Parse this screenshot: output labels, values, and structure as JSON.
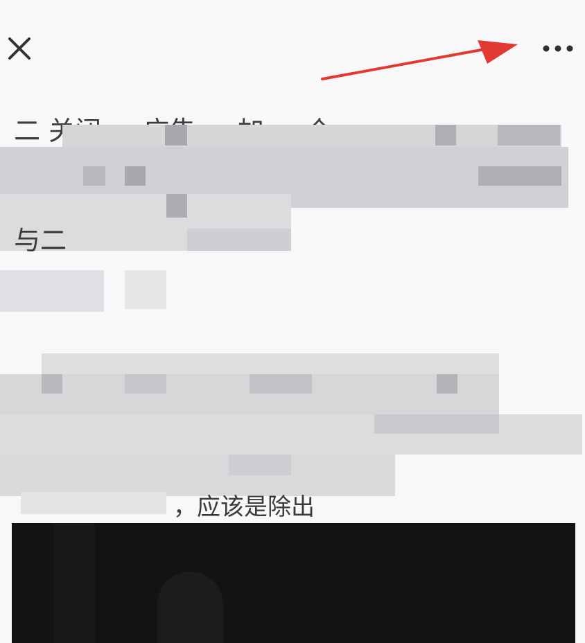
{
  "topbar": {
    "close_icon": "close-icon",
    "more_icon": "more-horizontal-icon",
    "annotation_color": "#e23a32"
  },
  "article": {
    "line1_fragment": "二 关闭 ... 广告 ... 加 ... 个 ...",
    "line3_fragment": "与二",
    "line_last_fragment": "，应该是除出"
  },
  "media": {
    "type": "video",
    "background": "#131313"
  }
}
